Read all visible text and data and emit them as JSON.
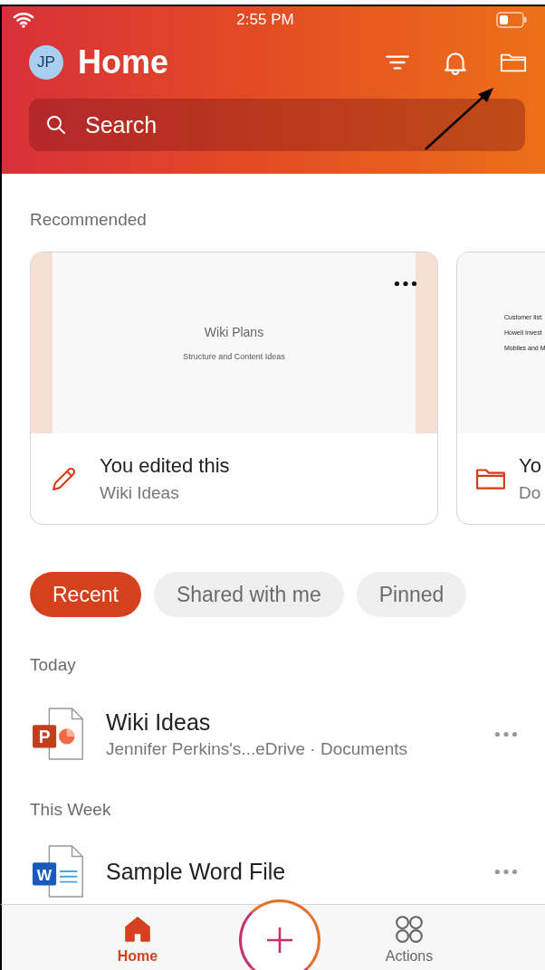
{
  "status_bar": {
    "time": "2:55 PM"
  },
  "header": {
    "avatar_initials": "JP",
    "title": "Home"
  },
  "search": {
    "placeholder": "Search"
  },
  "recommended": {
    "label": "Recommended",
    "cards": [
      {
        "kind": "edited",
        "preview_title": "Wiki Plans",
        "preview_subtitle": "Structure and Content Ideas",
        "activity": "You edited this",
        "file": "Wiki Ideas"
      },
      {
        "kind": "folder",
        "preview_lines": [
          "Customer list:",
          "Howell Invest",
          "Mobiles and M"
        ],
        "activity": "Yo",
        "file": "Do"
      }
    ]
  },
  "chips": [
    {
      "label": "Recent",
      "selected": true
    },
    {
      "label": "Shared with me",
      "selected": false
    },
    {
      "label": "Pinned",
      "selected": false
    }
  ],
  "sections": [
    {
      "label": "Today",
      "files": [
        {
          "kind": "powerpoint",
          "app_letter": "P",
          "name": "Wiki Ideas",
          "location": "Jennifer Perkins's...eDrive · Documents"
        }
      ]
    },
    {
      "label": "This Week",
      "files": [
        {
          "kind": "word",
          "app_letter": "W",
          "name": "Sample Word File"
        }
      ]
    }
  ],
  "nav": {
    "items": [
      {
        "kind": "home",
        "label": "Home",
        "selected": true
      },
      {
        "kind": "actions",
        "label": "Actions",
        "selected": false
      }
    ]
  }
}
